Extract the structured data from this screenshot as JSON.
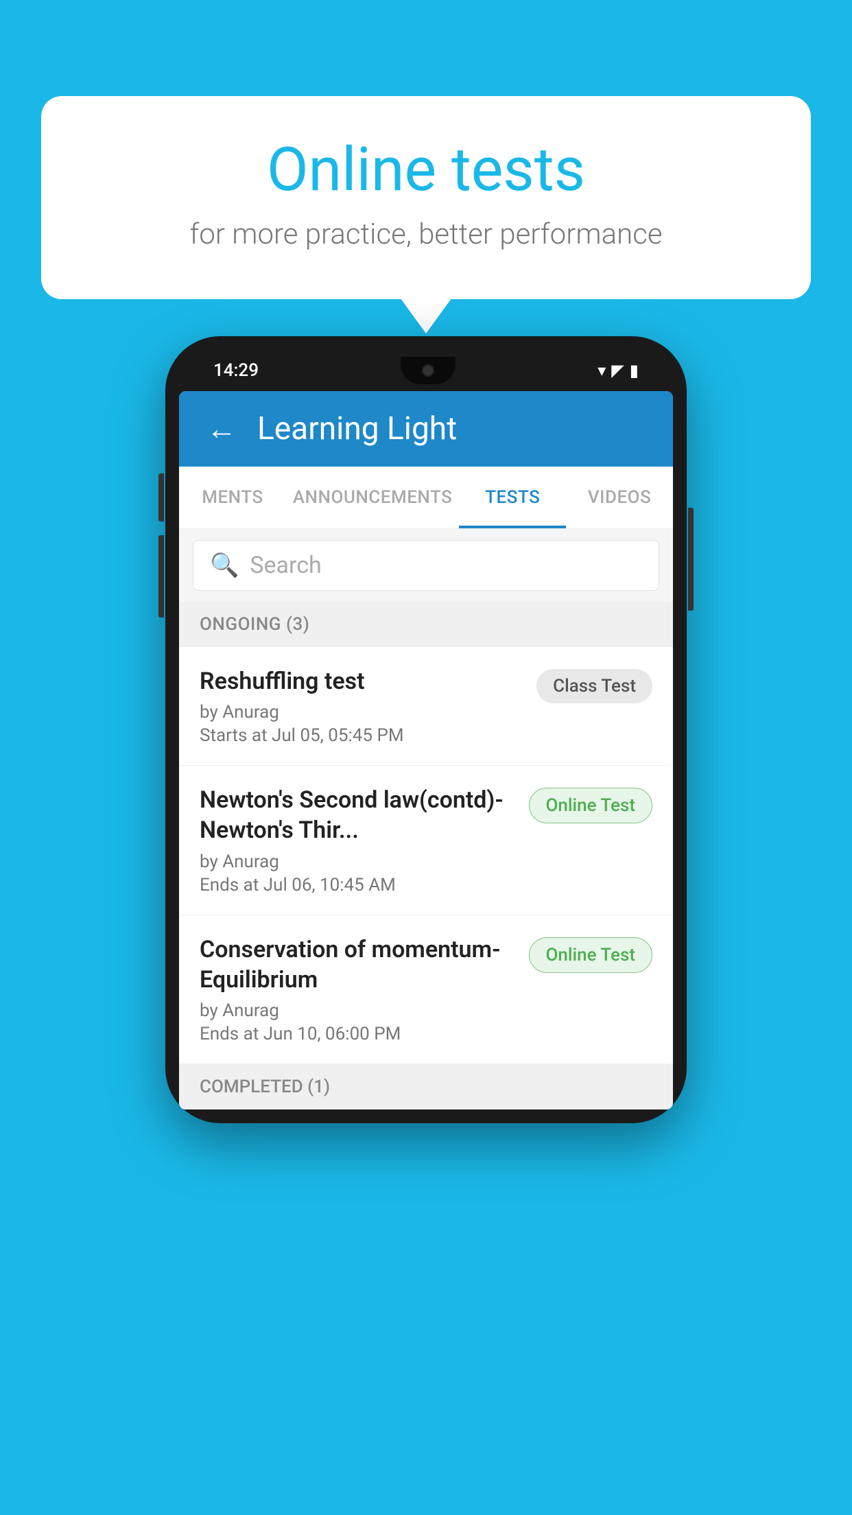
{
  "background_color": "#1ab8e8",
  "speech_bubble": {
    "title": "Online tests",
    "subtitle": "for more practice, better performance"
  },
  "phone": {
    "status_bar": {
      "time": "14:29",
      "icons": [
        "wifi",
        "signal",
        "battery"
      ]
    },
    "header": {
      "title": "Learning Light",
      "back_label": "←"
    },
    "tabs": [
      {
        "label": "MENTS",
        "active": false
      },
      {
        "label": "ANNOUNCEMENTS",
        "active": false
      },
      {
        "label": "TESTS",
        "active": true
      },
      {
        "label": "VIDEOS",
        "active": false
      }
    ],
    "search": {
      "placeholder": "Search"
    },
    "ongoing_section": {
      "label": "ONGOING (3)"
    },
    "test_items": [
      {
        "name": "Reshuffling test",
        "author": "by Anurag",
        "time": "Starts at  Jul 05, 05:45 PM",
        "badge": "Class Test",
        "badge_type": "class"
      },
      {
        "name": "Newton's Second law(contd)-Newton's Thir...",
        "author": "by Anurag",
        "time": "Ends at  Jul 06, 10:45 AM",
        "badge": "Online Test",
        "badge_type": "online"
      },
      {
        "name": "Conservation of momentum-Equilibrium",
        "author": "by Anurag",
        "time": "Ends at  Jun 10, 06:00 PM",
        "badge": "Online Test",
        "badge_type": "online"
      }
    ],
    "completed_section": {
      "label": "COMPLETED (1)"
    }
  }
}
